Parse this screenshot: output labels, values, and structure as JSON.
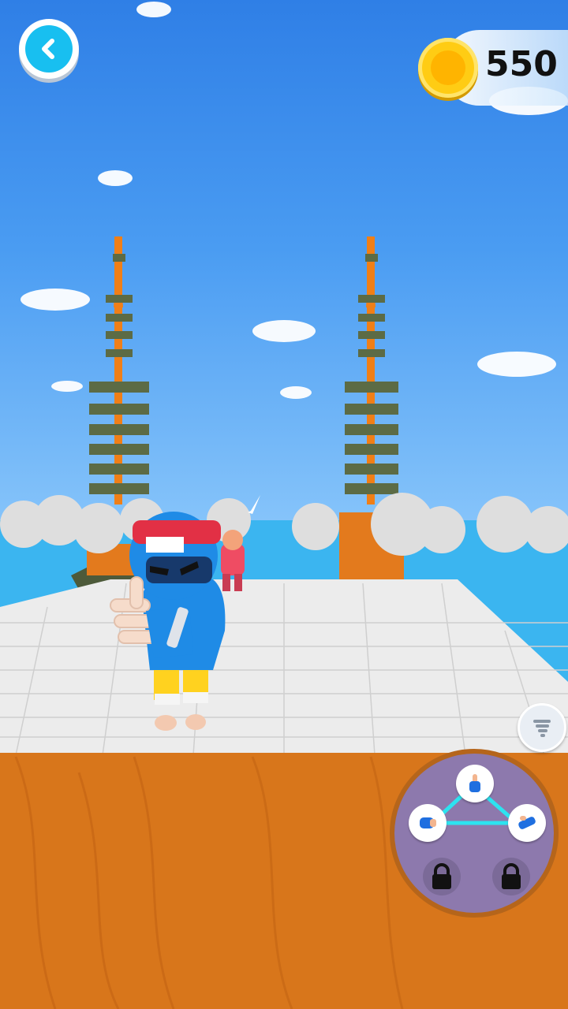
{
  "hud": {
    "coins": "550",
    "back_icon": "chevron-left-icon",
    "coin_icon": "gold-coin-icon",
    "special_icon": "tornado-icon"
  },
  "skills": {
    "slots": [
      {
        "icon": "hand-point-icon",
        "state": "unlocked"
      },
      {
        "icon": "fist-icon",
        "state": "unlocked"
      },
      {
        "icon": "open-palm-icon",
        "state": "unlocked"
      },
      {
        "icon": "lock-icon",
        "state": "locked"
      },
      {
        "icon": "lock-icon",
        "state": "locked"
      }
    ]
  },
  "colors": {
    "accent": "#18bff0",
    "coin": "#ffcc14",
    "wheel": "#8d79ad",
    "wheel_ring": "#b5651b",
    "link_line": "#2de3f0"
  }
}
